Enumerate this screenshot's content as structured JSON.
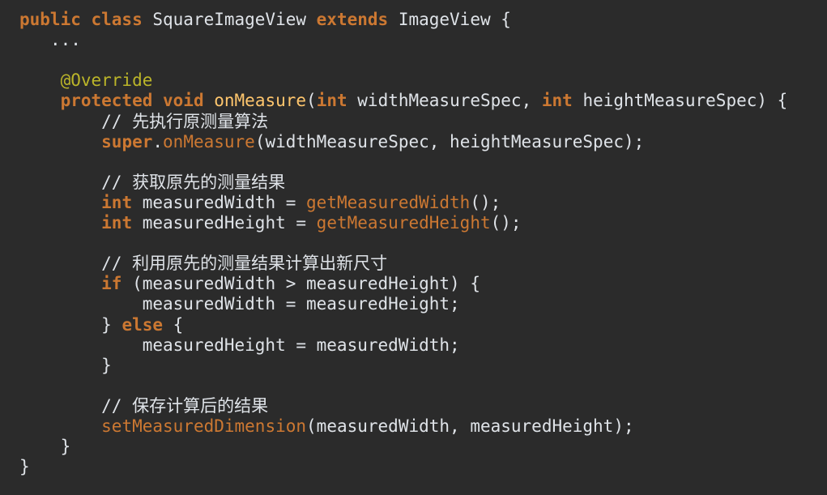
{
  "editor": {
    "background": "#2b2b2b",
    "colors": {
      "keyword": "#cc7832",
      "method_declaration": "#ffc66d",
      "method_call": "#cc7832",
      "annotation": "#bbb529",
      "text": "#dfe3e8"
    },
    "lines": [
      {
        "indent": "",
        "tokens": [
          {
            "type": "kw",
            "text": "public class"
          },
          {
            "type": "plain",
            "text": " SquareImageView "
          },
          {
            "type": "kw",
            "text": "extends"
          },
          {
            "type": "plain",
            "text": " ImageView {"
          }
        ]
      },
      {
        "indent": "   ",
        "tokens": [
          {
            "type": "plain",
            "text": "..."
          }
        ]
      },
      {
        "indent": "",
        "tokens": []
      },
      {
        "indent": "    ",
        "tokens": [
          {
            "type": "anno",
            "text": "@Override"
          }
        ]
      },
      {
        "indent": "    ",
        "tokens": [
          {
            "type": "kw",
            "text": "protected void"
          },
          {
            "type": "plain",
            "text": " "
          },
          {
            "type": "fn",
            "text": "onMeasure"
          },
          {
            "type": "plain",
            "text": "("
          },
          {
            "type": "kw",
            "text": "int"
          },
          {
            "type": "plain",
            "text": " widthMeasureSpec, "
          },
          {
            "type": "kw",
            "text": "int"
          },
          {
            "type": "plain",
            "text": " heightMeasureSpec) {"
          }
        ]
      },
      {
        "indent": "        ",
        "tokens": [
          {
            "type": "comment",
            "text": "// 先执行原测量算法"
          }
        ]
      },
      {
        "indent": "        ",
        "tokens": [
          {
            "type": "kw",
            "text": "super"
          },
          {
            "type": "plain",
            "text": "."
          },
          {
            "type": "call",
            "text": "onMeasure"
          },
          {
            "type": "plain",
            "text": "(widthMeasureSpec, heightMeasureSpec);"
          }
        ]
      },
      {
        "indent": "",
        "tokens": []
      },
      {
        "indent": "        ",
        "tokens": [
          {
            "type": "comment",
            "text": "// 获取原先的测量结果"
          }
        ]
      },
      {
        "indent": "        ",
        "tokens": [
          {
            "type": "kw",
            "text": "int"
          },
          {
            "type": "plain",
            "text": " measuredWidth = "
          },
          {
            "type": "call",
            "text": "getMeasuredWidth"
          },
          {
            "type": "plain",
            "text": "();"
          }
        ]
      },
      {
        "indent": "        ",
        "tokens": [
          {
            "type": "kw",
            "text": "int"
          },
          {
            "type": "plain",
            "text": " measuredHeight = "
          },
          {
            "type": "call",
            "text": "getMeasuredHeight"
          },
          {
            "type": "plain",
            "text": "();"
          }
        ]
      },
      {
        "indent": "",
        "tokens": []
      },
      {
        "indent": "        ",
        "tokens": [
          {
            "type": "comment",
            "text": "// 利用原先的测量结果计算出新尺寸"
          }
        ]
      },
      {
        "indent": "        ",
        "tokens": [
          {
            "type": "kw",
            "text": "if"
          },
          {
            "type": "plain",
            "text": " (measuredWidth > measuredHeight) {"
          }
        ]
      },
      {
        "indent": "            ",
        "tokens": [
          {
            "type": "plain",
            "text": "measuredWidth = measuredHeight;"
          }
        ]
      },
      {
        "indent": "        ",
        "tokens": [
          {
            "type": "plain",
            "text": "} "
          },
          {
            "type": "kw",
            "text": "else"
          },
          {
            "type": "plain",
            "text": " {"
          }
        ]
      },
      {
        "indent": "            ",
        "tokens": [
          {
            "type": "plain",
            "text": "measuredHeight = measuredWidth;"
          }
        ]
      },
      {
        "indent": "        ",
        "tokens": [
          {
            "type": "plain",
            "text": "}"
          }
        ]
      },
      {
        "indent": "",
        "tokens": []
      },
      {
        "indent": "        ",
        "tokens": [
          {
            "type": "comment",
            "text": "// 保存计算后的结果"
          }
        ]
      },
      {
        "indent": "        ",
        "tokens": [
          {
            "type": "call",
            "text": "setMeasuredDimension"
          },
          {
            "type": "plain",
            "text": "(measuredWidth, measuredHeight);"
          }
        ]
      },
      {
        "indent": "    ",
        "tokens": [
          {
            "type": "plain",
            "text": "}"
          }
        ]
      },
      {
        "indent": "",
        "tokens": [
          {
            "type": "plain",
            "text": "}"
          }
        ]
      }
    ]
  }
}
